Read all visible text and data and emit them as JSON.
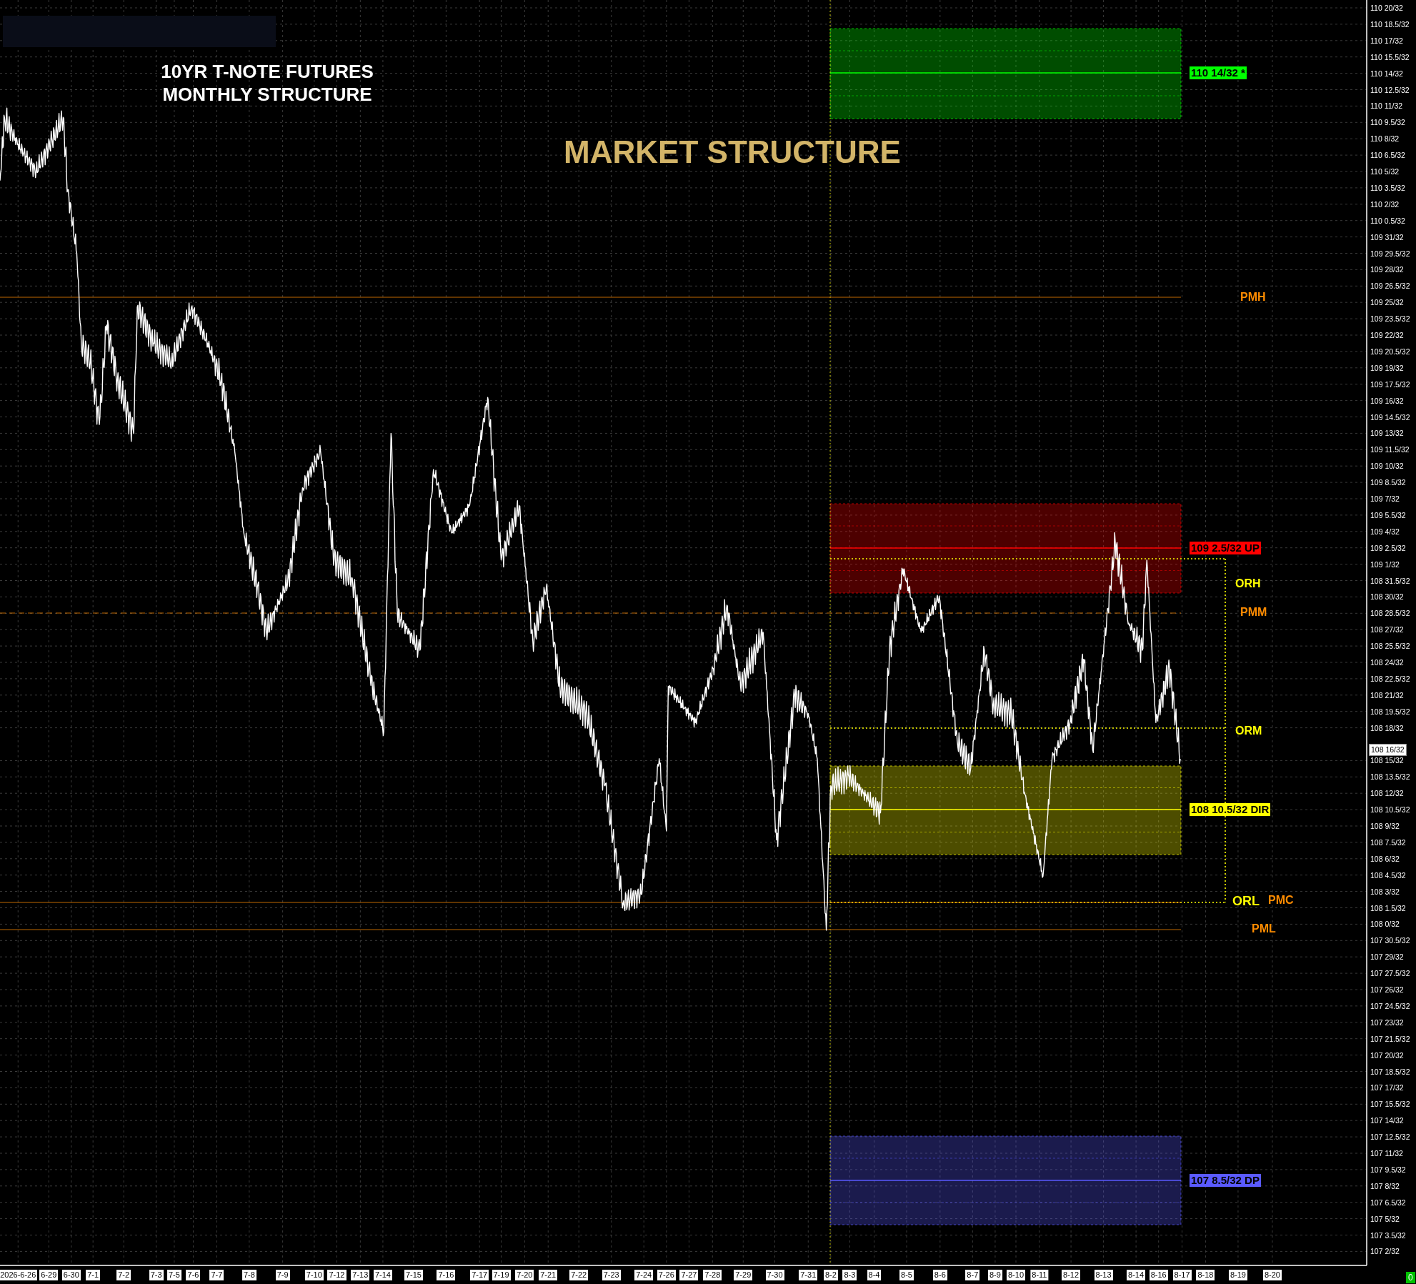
{
  "chart": {
    "title_lines": [
      "10YR T-NOTE FUTURES",
      "MONTHLY STRUCTURE"
    ],
    "heading": "MARKET STRUCTURE",
    "price_axis": {
      "labels": [
        "110 20/32",
        "110 18.5/32",
        "110 17/32",
        "110 15.5/32",
        "110 14/32",
        "110 12.5/32",
        "110 11/32",
        "110 9.5/32",
        "110 8/32",
        "110 6.5/32",
        "110 5/32",
        "110 3.5/32",
        "110 2/32",
        "110 0.5/32",
        "109 31/32",
        "109 29.5/32",
        "109 28/32",
        "109 26.5/32",
        "109 25/32",
        "109 23.5/32",
        "109 22/32",
        "109 20.5/32",
        "109 19/32",
        "109 17.5/32",
        "109 16/32",
        "109 14.5/32",
        "109 13/32",
        "109 11.5/32",
        "109 10/32",
        "109 8.5/32",
        "109 7/32",
        "109 5.5/32",
        "109 4/32",
        "109 2.5/32",
        "109 1/32",
        "108 31.5/32",
        "108 30/32",
        "108 28.5/32",
        "108 27/32",
        "108 25.5/32",
        "108 24/32",
        "108 22.5/32",
        "108 21/32",
        "108 19.5/32",
        "108 18/32",
        "108 15/32",
        "108 13.5/32",
        "108 12/32",
        "108 10.5/32",
        "108 9/32",
        "108 7.5/32",
        "108 6/32",
        "108 4.5/32",
        "108 3/32",
        "108 1.5/32",
        "108 0/32",
        "107 30.5/32",
        "107 29/32",
        "107 27.5/32",
        "107 26/32",
        "107 24.5/32",
        "107 23/32",
        "107 21.5/32",
        "107 20/32",
        "107 18.5/32",
        "107 17/32",
        "107 15.5/32",
        "107 14/32",
        "107 12.5/32",
        "107 11/32",
        "107 9.5/32",
        "107 8/32",
        "107 6.5/32",
        "107 5/32",
        "107 3.5/32",
        "107 2/32"
      ],
      "current_price": "108 16/32"
    },
    "date_axis": {
      "labels": [
        "2026-6-26",
        "6-29",
        "6-30",
        "7-1",
        "7-2",
        "7-3",
        "7-5",
        "7-6",
        "7-7",
        "7-8",
        "7-9",
        "7-10",
        "7-12",
        "7-13",
        "7-14",
        "7-15",
        "7-16",
        "7-17",
        "7-19",
        "7-20",
        "7-21",
        "7-22",
        "7-23",
        "7-24",
        "7-26",
        "7-27",
        "7-28",
        "7-29",
        "7-30",
        "7-31",
        "8-2",
        "8-3",
        "8-4",
        "8-5",
        "8-6",
        "8-7",
        "8-9",
        "8-10",
        "8-11",
        "8-12",
        "8-13",
        "8-14",
        "8-16",
        "8-17",
        "8-18",
        "8-19",
        "8-20"
      ]
    },
    "zones": [
      {
        "label": "110 14/32 *",
        "color": "#00ff00"
      },
      {
        "label": "109 2.5/32 UP",
        "color": "#ff0000"
      },
      {
        "label": "108 10.5/32 DIR",
        "color": "#ffff00"
      },
      {
        "label": "107 8.5/32 DP",
        "color": "#5a5aff"
      }
    ],
    "levels": [
      {
        "label": "PMH",
        "kind": "solid",
        "color": "#ff8c00"
      },
      {
        "label": "ORH",
        "kind": "dotted",
        "color": "#ffff00"
      },
      {
        "label": "PMM",
        "kind": "dashed",
        "color": "#ff8c00"
      },
      {
        "label": "ORM",
        "kind": "dotted",
        "color": "#ffff00"
      },
      {
        "label": "ORL",
        "kind": "dotted",
        "color": "#ffff00"
      },
      {
        "label": "PMC",
        "kind": "solid",
        "color": "#ff8c00"
      },
      {
        "label": "PML",
        "kind": "solid",
        "color": "#ff8c00"
      }
    ],
    "counter": "0"
  }
}
